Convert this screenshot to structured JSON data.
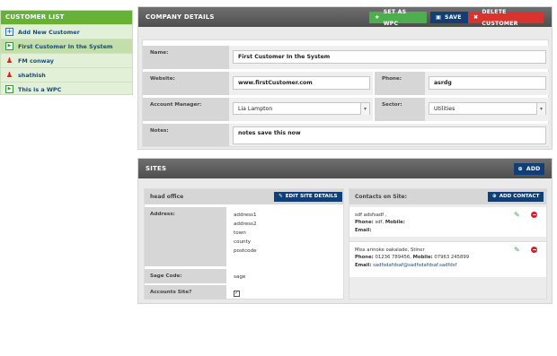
{
  "sidebar": {
    "title": "CUSTOMER LIST",
    "items": [
      {
        "label": "Add New Customer",
        "icon": "add-icon"
      },
      {
        "label": "First Customer In the System",
        "icon": "box-icon",
        "active": true
      },
      {
        "label": "FM conway",
        "icon": "person-icon"
      },
      {
        "label": "shathish",
        "icon": "person-icon"
      },
      {
        "label": "This is a WPC",
        "icon": "box-icon"
      }
    ]
  },
  "company": {
    "title": "COMPANY DETAILS",
    "set_as_wpc_label": "SET AS WPC",
    "save_label": "SAVE",
    "delete_label": "DELETE CUSTOMER",
    "name_label": "Name:",
    "name_value": "First Customer In the System",
    "website_label": "Website:",
    "website_value": "www.firstCustomer.com",
    "phone_label": "Phone:",
    "phone_value": "asrdg",
    "account_manager_label": "Account Manager:",
    "account_manager_value": "Lia Lampton",
    "sector_label": "Sector:",
    "sector_value": "Utilities",
    "notes_label": "Notes:",
    "notes_value": "notes save this now"
  },
  "sites": {
    "title": "SITES",
    "add_label": "ADD",
    "site_name": "head office",
    "edit_site_label": "EDIT SITE DETAILS",
    "address_label": "Address:",
    "address_lines": [
      "address1",
      "address2",
      "town",
      "county",
      "postcode"
    ],
    "sage_code_label": "Sage Code:",
    "sage_code_value": "sage",
    "accounts_site_label": "Accounts Site?",
    "accounts_site_checked": true,
    "contacts_header": "Contacts on Site:",
    "add_contact_label": "ADD CONTACT",
    "contacts": [
      {
        "name": "sdf adsfsadf ,",
        "phone_label": "Phone:",
        "phone": "sdf,",
        "mobile_label": "Mobile:",
        "mobile": "",
        "email_label": "Email:",
        "email": ""
      },
      {
        "name": "Miss arinoke oakalade, Stiner",
        "phone_label": "Phone:",
        "phone": "01236 789456,",
        "mobile_label": "Mobile:",
        "mobile": "07963 245899",
        "email_label": "Email:",
        "email": "sadfsdafdsaf@sadfsdafdsaf.sadfdsf"
      }
    ]
  },
  "colors": {
    "sidebar_header": "#67b236",
    "sidebar_bg": "#e3f0d8",
    "wpc_button": "#4cae4c",
    "save_button": "#0f3f75",
    "delete_button": "#d9332e",
    "panel_header": "#5a5a5a"
  }
}
